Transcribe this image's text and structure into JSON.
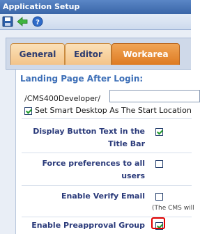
{
  "window": {
    "title": "Application Setup"
  },
  "toolbar": {
    "save_icon": "save-icon",
    "back_icon": "back-arrow-icon",
    "help_icon": "help-icon"
  },
  "tabs": [
    {
      "label": "General",
      "active": false
    },
    {
      "label": "Editor",
      "active": false
    },
    {
      "label": "Workarea",
      "active": true
    }
  ],
  "landing": {
    "title": "Landing Page After Login:",
    "path_prefix": "/CMS400Developer/",
    "path_value": "",
    "smart_desktop_label": "Set Smart Desktop As The Start Location",
    "smart_desktop_checked": true
  },
  "options": [
    {
      "label": "Display Button Text in the Title Bar",
      "checked": true
    },
    {
      "label": "Force preferences to all users",
      "checked": false
    },
    {
      "label": "Enable Verify Email",
      "checked": false,
      "note": "(The CMS will"
    },
    {
      "label": "Enable Preapproval Group",
      "checked": true
    }
  ],
  "colors": {
    "accent_tab": "#de7b22",
    "title_text": "#3d6fb7",
    "highlight": "#e00000"
  }
}
